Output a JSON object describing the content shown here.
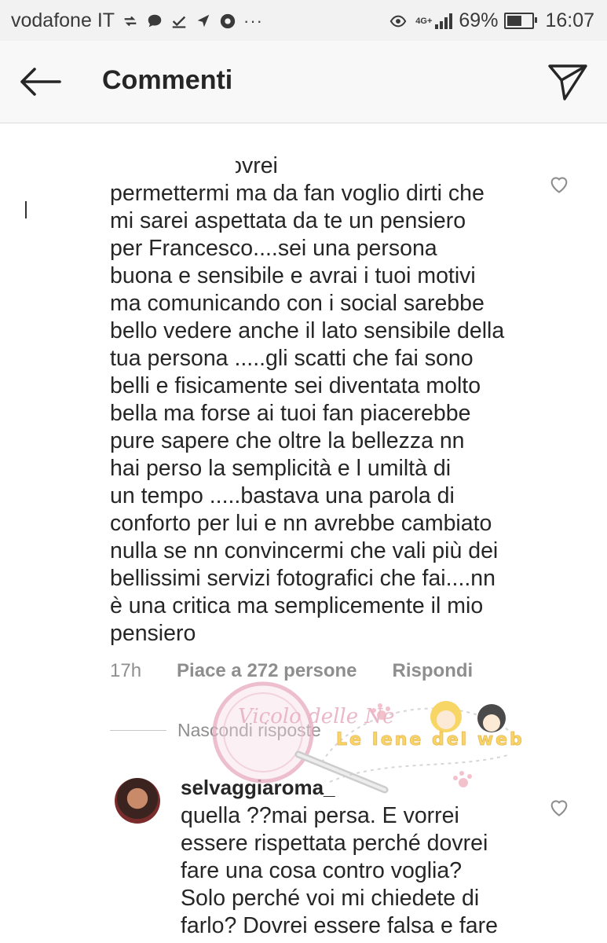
{
  "status_bar": {
    "carrier": "vodafone IT",
    "network": "4G+",
    "battery_percent": "69%",
    "battery_level": 0.69,
    "time": "16:07"
  },
  "header": {
    "title": "Commenti",
    "back_icon": "back-arrow-icon",
    "send_icon": "paper-plane-icon"
  },
  "comment": {
    "text": "So che nn dovrei\npermettermi ma da fan voglio dirti che\nmi sarei aspettata da te un pensiero\nper Francesco....sei una persona\nbuona e sensibile e avrai i tuoi motivi\nma comunicando con i social sarebbe\nbello vedere anche il lato sensibile della\ntua persona .....gli scatti che fai sono\nbelli e fisicamente sei diventata molto\nbella ma forse ai tuoi fan piacerebbe\npure sapere che oltre la bellezza nn\nhai perso la semplicità e l umiltà di\nun tempo .....bastava una parola di\nconforto per lui e nn avrebbe cambiato\nnulla se nn convincermi che vali più dei\nbellissimi servizi fotografici che fai....nn\nè una critica ma semplicemente il mio\npensiero",
    "time": "17h",
    "likes": "Piace a 272 persone",
    "reply_label": "Rispondi",
    "hide_replies_label": "Nascondi risposte"
  },
  "reply": {
    "username": "selvaggiaroma_",
    "text": "quella ??mai persa. E vorrei\nessere rispettata perché dovrei\nfare una cosa contro voglia?\nSolo perché voi mi chiedete di\nfarlo? Dovrei essere falsa e fare"
  },
  "watermarks": {
    "left": "Vicolo delle News",
    "right": "Le Iene del web"
  },
  "colors": {
    "text": "#262626",
    "muted": "#8e8e8e",
    "header_bg": "#f8f8f8",
    "statusbar_bg": "#f2f2f2"
  }
}
